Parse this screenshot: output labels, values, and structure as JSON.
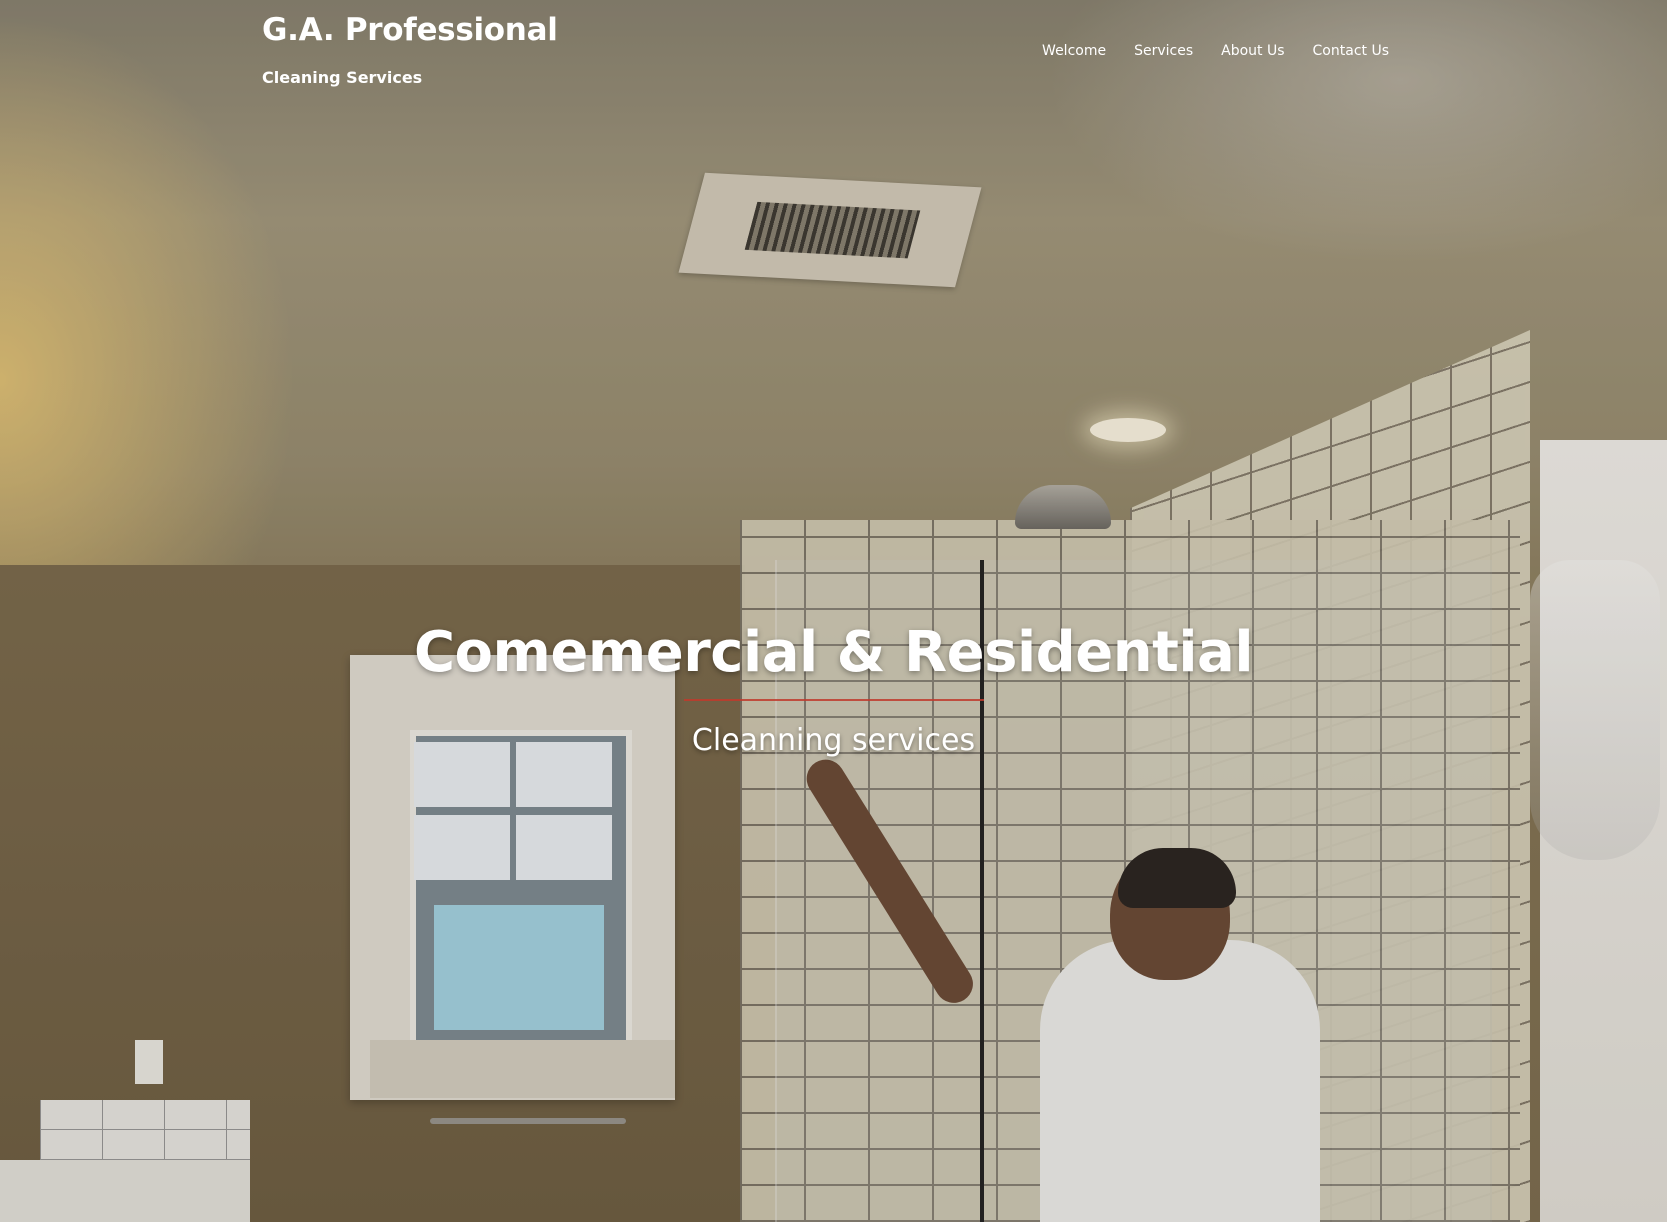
{
  "site": {
    "title": "G.A. Professional",
    "tagline": "Cleaning Services"
  },
  "nav": {
    "items": [
      {
        "label": "Welcome"
      },
      {
        "label": "Services"
      },
      {
        "label": "About Us"
      },
      {
        "label": "Contact Us"
      }
    ]
  },
  "hero": {
    "heading": "Comemercial & Residential",
    "subheading": "Cleanning services",
    "divider_color": "#c0392b",
    "background_image": "bathroom-shower-cleaning-photo"
  }
}
